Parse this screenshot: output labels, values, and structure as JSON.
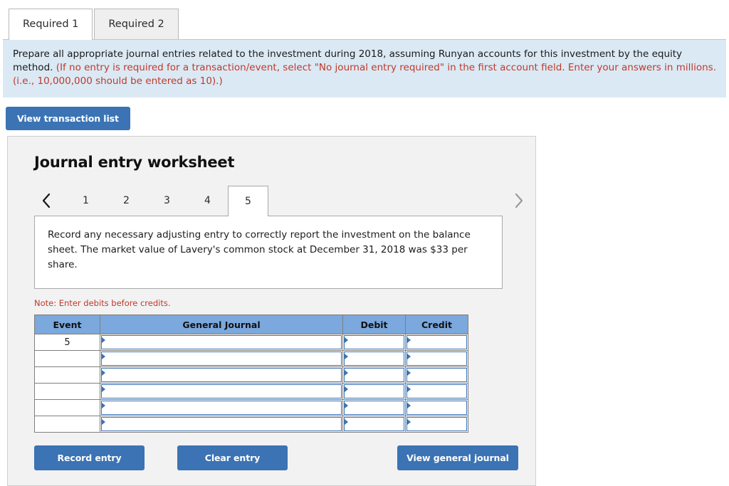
{
  "tabs": [
    {
      "label": "Required 1",
      "active": true
    },
    {
      "label": "Required 2",
      "active": false
    }
  ],
  "instructions": {
    "black_text": "Prepare all appropriate journal entries related to the investment during 2018, assuming Runyan accounts for this investment by the equity method. ",
    "red_text": "(If no entry is required for a transaction/event, select \"No journal entry required\" in the first account field. Enter your answers in millions. (i.e., 10,000,000 should be entered as 10).)"
  },
  "toolbar": {
    "view_transaction_list_label": "View transaction list"
  },
  "worksheet": {
    "title": "Journal entry worksheet",
    "pager": {
      "prev_icon": "chevron-left-icon",
      "next_icon": "chevron-right-icon",
      "pages": [
        "1",
        "2",
        "3",
        "4",
        "5"
      ],
      "active_page": "5"
    },
    "scenario_text": "Record any necessary adjusting entry to correctly report the investment on the balance sheet. The market value of Lavery's common stock at December 31, 2018 was $33 per share.",
    "note": "Note: Enter debits before credits.",
    "table": {
      "headers": [
        "Event",
        "General Journal",
        "Debit",
        "Credit"
      ],
      "rows": [
        {
          "event": "5",
          "general_journal": "",
          "debit": "",
          "credit": ""
        },
        {
          "event": "",
          "general_journal": "",
          "debit": "",
          "credit": ""
        },
        {
          "event": "",
          "general_journal": "",
          "debit": "",
          "credit": ""
        },
        {
          "event": "",
          "general_journal": "",
          "debit": "",
          "credit": ""
        },
        {
          "event": "",
          "general_journal": "",
          "debit": "",
          "credit": ""
        },
        {
          "event": "",
          "general_journal": "",
          "debit": "",
          "credit": ""
        }
      ]
    },
    "buttons": {
      "record_entry": "Record entry",
      "clear_entry": "Clear entry",
      "view_general_journal": "View general journal"
    }
  },
  "colors": {
    "button_blue": "#3b73b4",
    "header_blue": "#7ba8dd",
    "banner_blue": "#dbe9f4",
    "note_red": "#c0392b",
    "panel_gray": "#f2f2f2"
  }
}
